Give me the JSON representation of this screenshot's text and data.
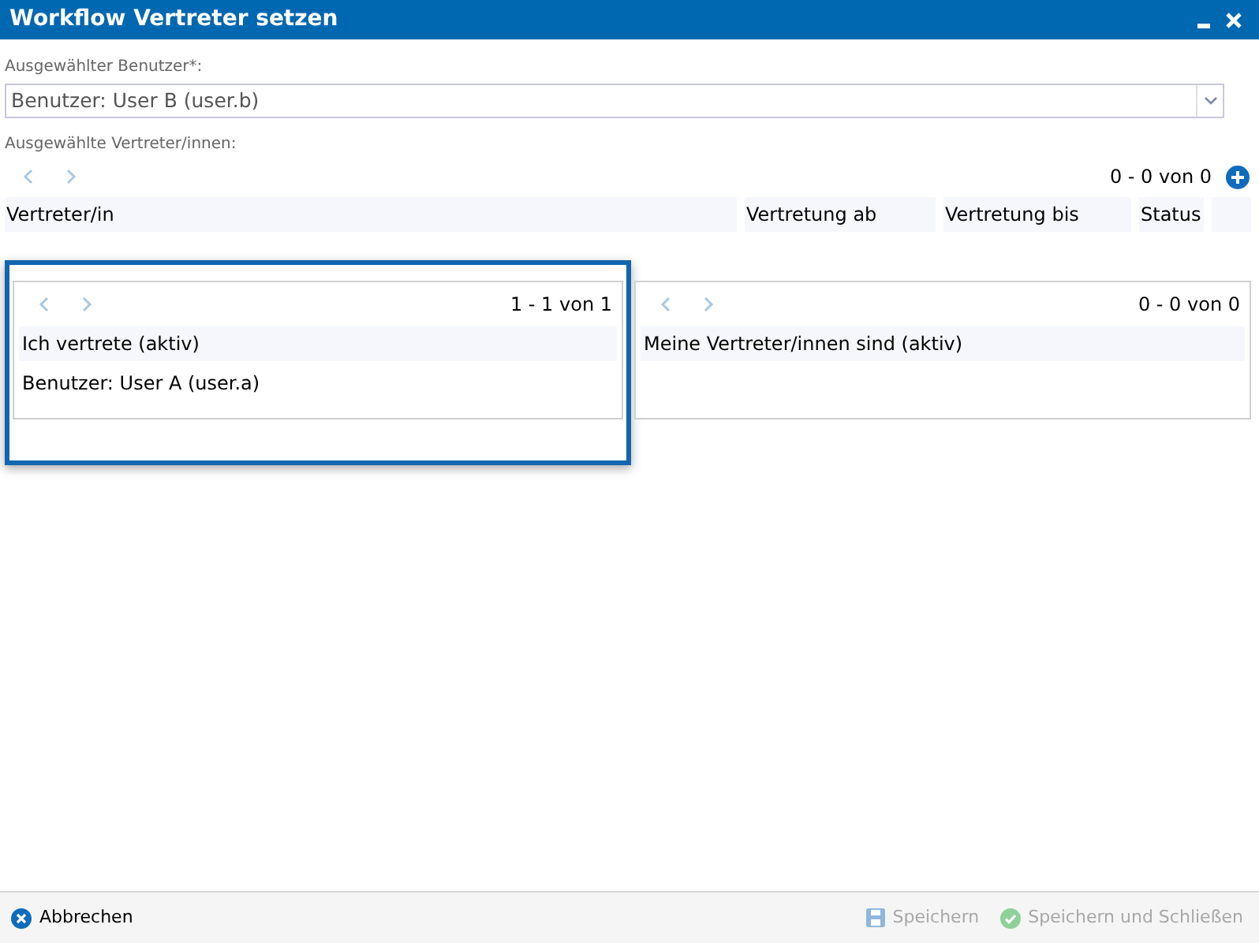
{
  "window": {
    "title": "Workflow Vertreter setzen"
  },
  "user_field": {
    "label": "Ausgewählter Benutzer*:",
    "value": "Benutzer: User B (user.b)"
  },
  "substitutes": {
    "label": "Ausgewählte Vertreter/innen:",
    "pager": "0 - 0 von 0",
    "columns": [
      "Vertreter/in",
      "Vertretung ab",
      "Vertretung bis",
      "Status"
    ]
  },
  "panels": [
    {
      "highlighted": true,
      "pager": "1 - 1 von 1",
      "heading": "Ich vertrete (aktiv)",
      "rows": [
        "Benutzer: User A (user.a)"
      ]
    },
    {
      "highlighted": false,
      "pager": "0 - 0 von 0",
      "heading": "Meine Vertreter/innen sind (aktiv)"
    }
  ],
  "footer": {
    "cancel": {
      "label": "Abbrechen"
    },
    "actions": [
      {
        "kind": "save",
        "label": "Speichern",
        "disabled": true
      },
      {
        "kind": "save_close",
        "label": "Speichern und Schließen",
        "disabled": true
      }
    ]
  }
}
